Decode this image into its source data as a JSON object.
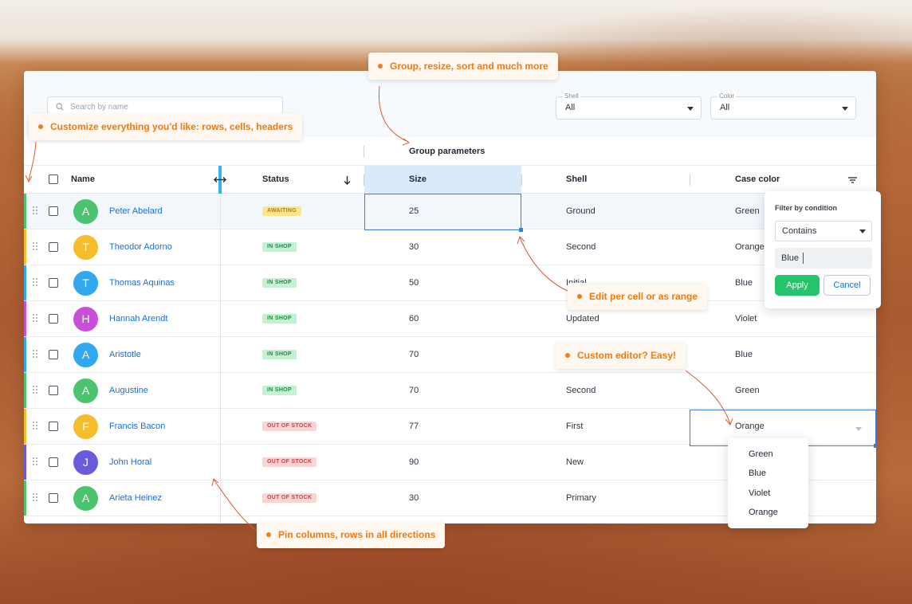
{
  "search": {
    "placeholder": "Search by name"
  },
  "filters": {
    "shell": {
      "label": "Shell",
      "value": "All"
    },
    "color": {
      "label": "Color",
      "value": "All"
    }
  },
  "group_header": "Group parameters",
  "columns": {
    "name": "Name",
    "status": "Status",
    "size": "Size",
    "shell": "Shell",
    "case_color": "Case color"
  },
  "rows": [
    {
      "initial": "A",
      "avatar_color": "#4cc36e",
      "bar_color": "#4cc36e",
      "name": "Peter Abelard",
      "status": "AWAITING",
      "size": "25",
      "shell": "Ground",
      "case_color": "Green"
    },
    {
      "initial": "T",
      "avatar_color": "#f5bd2c",
      "bar_color": "#f5bd2c",
      "name": "Theodor Adorno",
      "status": "IN SHOP",
      "size": "30",
      "shell": "Second",
      "case_color": "Orange"
    },
    {
      "initial": "T",
      "avatar_color": "#2fa8ef",
      "bar_color": "#2fa8ef",
      "name": "Thomas Aquinas",
      "status": "IN SHOP",
      "size": "50",
      "shell": "Initial",
      "case_color": "Blue"
    },
    {
      "initial": "H",
      "avatar_color": "#c84fd8",
      "bar_color": "#c84fd8",
      "name": "Hannah Arendt",
      "status": "IN SHOP",
      "size": "60",
      "shell": "Updated",
      "case_color": "Violet"
    },
    {
      "initial": "A",
      "avatar_color": "#2fa8ef",
      "bar_color": "#2fa8ef",
      "name": "Aristotle",
      "status": "IN SHOP",
      "size": "70",
      "shell": "",
      "case_color": "Blue"
    },
    {
      "initial": "A",
      "avatar_color": "#4cc36e",
      "bar_color": "#4cc36e",
      "name": "Augustine",
      "status": "IN SHOP",
      "size": "70",
      "shell": "Second",
      "case_color": "Green"
    },
    {
      "initial": "F",
      "avatar_color": "#f5bd2c",
      "bar_color": "#f5bd2c",
      "name": "Francis Bacon",
      "status": "OUT OF STOCK",
      "size": "77",
      "shell": "First",
      "case_color": "Orange"
    },
    {
      "initial": "J",
      "avatar_color": "#6a5bdc",
      "bar_color": "#6a5bdc",
      "name": "John Horal",
      "status": "OUT OF STOCK",
      "size": "90",
      "shell": "New",
      "case_color": ""
    },
    {
      "initial": "A",
      "avatar_color": "#4cc36e",
      "bar_color": "#4cc36e",
      "name": "Arieta Heinez",
      "status": "OUT OF STOCK",
      "size": "30",
      "shell": "Primary",
      "case_color": ""
    }
  ],
  "status_styles": {
    "AWAITING": {
      "bg": "#fde68a",
      "fg": "#b7791f"
    },
    "IN SHOP": {
      "bg": "#c6f0d2",
      "fg": "#1f8a4c"
    },
    "OUT OF STOCK": {
      "bg": "#fdd4d4",
      "fg": "#d63a3a"
    }
  },
  "filter_popup": {
    "title": "Filter by condition",
    "condition": "Contains",
    "value": "Blue",
    "apply_label": "Apply",
    "cancel_label": "Cancel"
  },
  "color_dropdown": {
    "options": [
      "Green",
      "Blue",
      "Violet",
      "Orange"
    ]
  },
  "callouts": {
    "group": "Group, resize, sort and much more",
    "customize": "Customize everything you'd like: rows, cells, headers",
    "edit": "Edit per cell or as range",
    "editor": "Custom editor? Easy!",
    "pin": "Pin columns, rows in all directions"
  },
  "colors": {
    "accent": "#ef7a12",
    "link": "#1a6fd6",
    "selection": "#3a7bdb",
    "apply": "#23c46a"
  },
  "icons": [
    "search-icon",
    "chevron-down-icon",
    "resize-icon",
    "sort-down-icon",
    "filter-icon",
    "drag-handle-icon"
  ]
}
